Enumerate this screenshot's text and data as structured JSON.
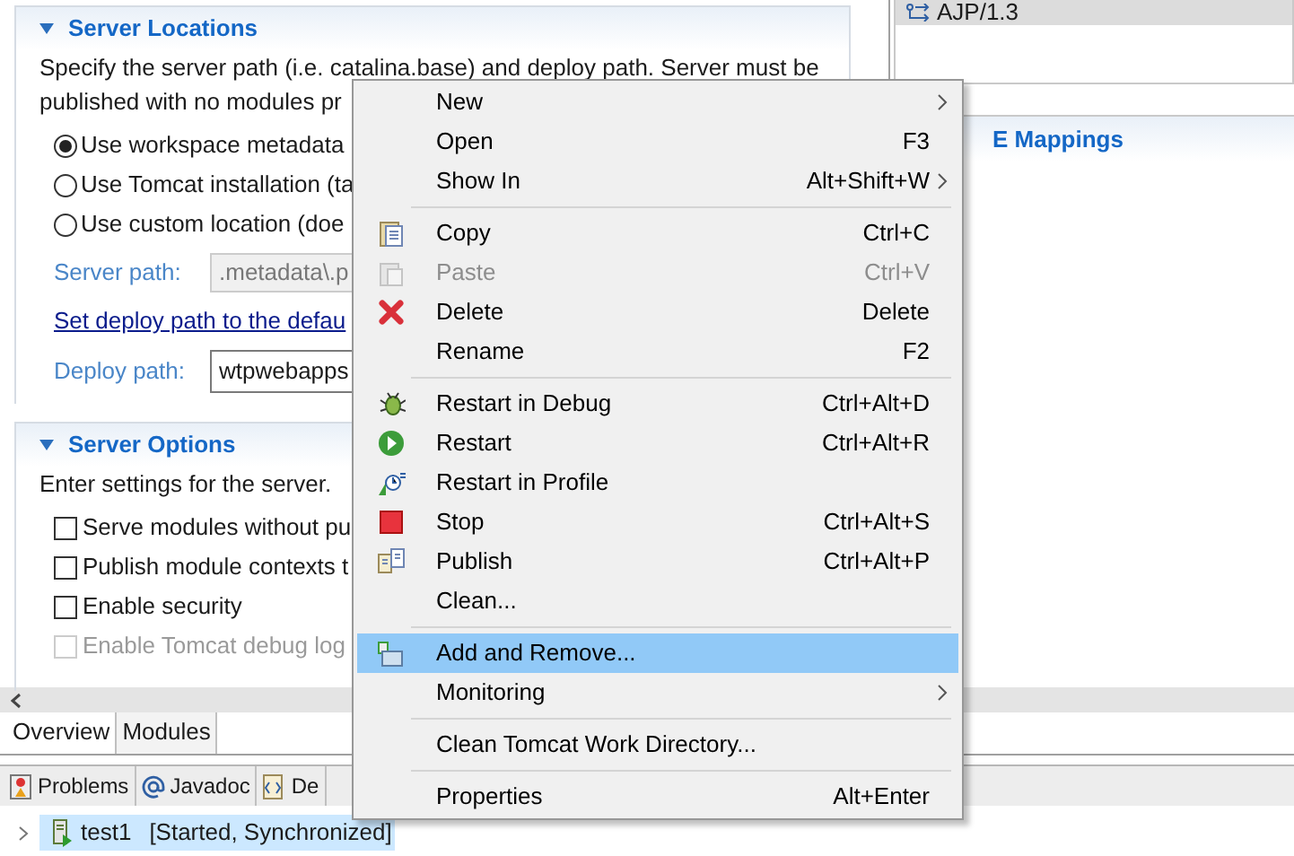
{
  "server_locations": {
    "title": "Server Locations",
    "expanded": true,
    "description": [
      "Specify the server path (i.e. catalina.base) and deploy path. Server must be",
      "published with no modules pr"
    ],
    "options": [
      {
        "label": "Use workspace metadata",
        "selected": true
      },
      {
        "label": "Use Tomcat installation (ta",
        "selected": false
      },
      {
        "label": "Use custom location (doe",
        "selected": false
      }
    ],
    "server_path": {
      "label": "Server path:",
      "value": ".metadata\\.p",
      "disabled": true
    },
    "link": "Set deploy path to the defau",
    "deploy_path": {
      "label": "Deploy path:",
      "value": "wtpwebapps"
    }
  },
  "server_options": {
    "title": "Server Options",
    "expanded": true,
    "description": "Enter settings for the server.",
    "checkboxes": [
      {
        "label": "Serve modules without pu",
        "checked": false,
        "disabled": false
      },
      {
        "label": "Publish module contexts t",
        "checked": false,
        "disabled": false
      },
      {
        "label": "Enable security",
        "checked": false,
        "disabled": false
      },
      {
        "label": "Enable Tomcat debug log",
        "checked": false,
        "disabled": true
      }
    ]
  },
  "ports": {
    "row": "AJP/1.3"
  },
  "mappings": {
    "title": "E Mappings"
  },
  "editor_tabs": [
    {
      "label": "Overview",
      "selected": true
    },
    {
      "label": "Modules",
      "selected": false
    }
  ],
  "view_tabs": [
    {
      "label": "Problems"
    },
    {
      "label": "Javadoc"
    },
    {
      "label": "De"
    }
  ],
  "servers": [
    {
      "name": "test1",
      "status": "[Started, Synchronized]",
      "selected": true
    }
  ],
  "context_menu": [
    [
      {
        "label": "New",
        "submenu": true,
        "disabled": false,
        "selected": false
      },
      {
        "label": "Open",
        "shortcut": "F3",
        "submenu": false,
        "disabled": false,
        "selected": false
      },
      {
        "label": "Show In",
        "shortcut": "Alt+Shift+W",
        "submenu": true,
        "disabled": false,
        "selected": false
      }
    ],
    [
      {
        "label": "Copy",
        "shortcut": "Ctrl+C",
        "submenu": false,
        "disabled": false,
        "selected": false
      },
      {
        "label": "Paste",
        "shortcut": "Ctrl+V",
        "submenu": false,
        "disabled": true,
        "selected": false
      },
      {
        "label": "Delete",
        "shortcut": "Delete",
        "submenu": false,
        "disabled": false,
        "selected": false
      },
      {
        "label": "Rename",
        "shortcut": "F2",
        "submenu": false,
        "disabled": false,
        "selected": false
      }
    ],
    [
      {
        "label": "Restart in Debug",
        "shortcut": "Ctrl+Alt+D",
        "submenu": false,
        "disabled": false,
        "selected": false
      },
      {
        "label": "Restart",
        "shortcut": "Ctrl+Alt+R",
        "submenu": false,
        "disabled": false,
        "selected": false
      },
      {
        "label": "Restart in Profile",
        "submenu": false,
        "disabled": false,
        "selected": false
      },
      {
        "label": "Stop",
        "shortcut": "Ctrl+Alt+S",
        "submenu": false,
        "disabled": false,
        "selected": false
      },
      {
        "label": "Publish",
        "shortcut": "Ctrl+Alt+P",
        "submenu": false,
        "disabled": false,
        "selected": false
      },
      {
        "label": "Clean...",
        "submenu": false,
        "disabled": false,
        "selected": false
      }
    ],
    [
      {
        "label": "Add and Remove...",
        "submenu": false,
        "disabled": false,
        "selected": true
      },
      {
        "label": "Monitoring",
        "submenu": true,
        "disabled": false,
        "selected": false
      }
    ],
    [
      {
        "label": "Clean Tomcat Work Directory...",
        "submenu": false,
        "disabled": false,
        "selected": false
      }
    ],
    [
      {
        "label": "Properties",
        "shortcut": "Alt+Enter",
        "submenu": false,
        "disabled": false,
        "selected": false
      }
    ]
  ]
}
